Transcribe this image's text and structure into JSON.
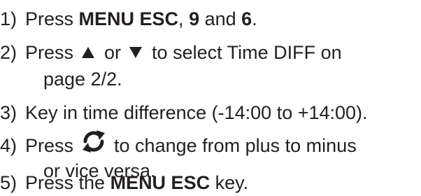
{
  "steps": [
    {
      "num": "1)",
      "parts": {
        "a": "Press ",
        "b": "MENU ESC",
        "c": ", ",
        "d": "9",
        "e": " and ",
        "f": "6",
        "g": "."
      }
    },
    {
      "num": "2)",
      "parts": {
        "a": "Press",
        "icon1": "up-triangle",
        "b": "or",
        "icon2": "down-triangle",
        "c": "to select Time DIFF on",
        "d": "page 2/2."
      }
    },
    {
      "num": "3)",
      "parts": {
        "a": "Key in time difference (-14:00 to +14:00)."
      }
    },
    {
      "num": "4)",
      "parts": {
        "a": "Press",
        "icon": "cycle-arrows",
        "b": "to change from plus to minus",
        "c": "or vice versa."
      }
    },
    {
      "num": "5)",
      "parts": {
        "a": "Press the ",
        "b": "MENU ESC",
        "c": " key."
      }
    }
  ],
  "colors": {
    "text": "#231f20",
    "background": "#ffffff"
  }
}
